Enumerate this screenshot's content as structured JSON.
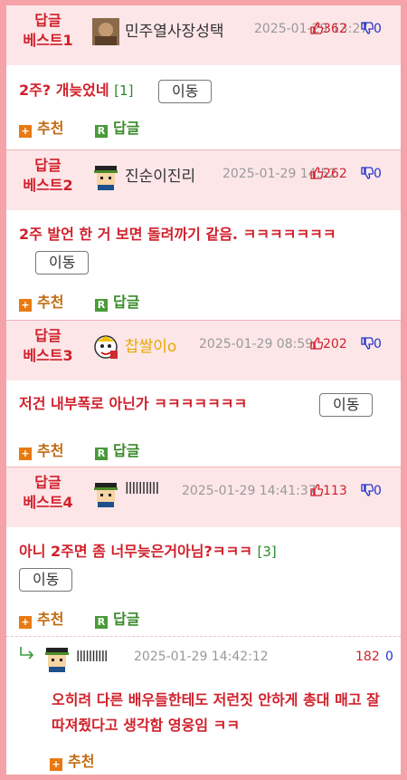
{
  "labels": {
    "move": "이동",
    "recommend": "추천",
    "reply": "답글"
  },
  "comments": [
    {
      "rank_line1": "답글",
      "rank_line2": "베스트1",
      "nick": "민주열사장성택",
      "date": "2025-01-29 13:27",
      "up": "362",
      "down": "0",
      "text": "2주? 개늦었네",
      "reply_count": "[1]"
    },
    {
      "rank_line1": "답글",
      "rank_line2": "베스트2",
      "nick": "진순이진리",
      "date": "2025-01-29 14:52",
      "up": "262",
      "down": "0",
      "text": "2주 발언 한 거 보면 돌려까기 같음. ㅋㅋㅋㅋㅋㅋㅋ",
      "reply_count": ""
    },
    {
      "rank_line1": "답글",
      "rank_line2": "베스트3",
      "nick": "찹쌀이o",
      "date": "2025-01-29 08:59:",
      "up": "202",
      "down": "0",
      "text": "저건 내부폭로 아닌가 ㅋㅋㅋㅋㅋㅋㅋ",
      "reply_count": ""
    },
    {
      "rank_line1": "답글",
      "rank_line2": "베스트4",
      "nick": "llllllllll",
      "date": "2025-01-29 14:41:37",
      "up": "113",
      "down": "0",
      "text": "아니 2주면 좀 너무늦은거아님?ㅋㅋㅋ",
      "reply_count": "[3]"
    }
  ],
  "reply": {
    "nick": "llllllllll",
    "date": "2025-01-29 14:42:12",
    "up": "182",
    "down": "0",
    "text": "오히려 다른 배우들한테도 저런짓 안하게 총대 매고 잘 따져줬다고 생각함 영웅임 ㅋㅋ"
  },
  "colors": {
    "accent_red": "#d0202b",
    "frame_pink": "#f5a3a8",
    "header_bg": "#fde6e8",
    "down_blue": "#2233cc",
    "green": "#3a8a2a",
    "orange": "#e87a12"
  },
  "icons": [
    "thumbs-up-icon",
    "thumbs-down-icon",
    "plus-square-icon",
    "reply-r-icon",
    "reply-arrow-icon",
    "avatar"
  ]
}
